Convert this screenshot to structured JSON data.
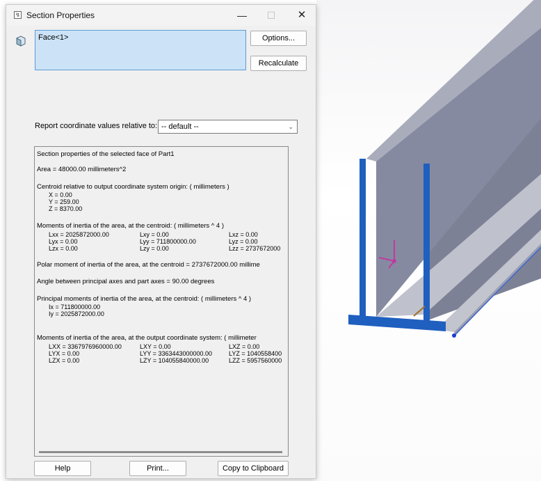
{
  "window": {
    "title": "Section Properties"
  },
  "selection": {
    "items": [
      "Face<1>"
    ]
  },
  "buttons": {
    "options": "Options...",
    "recalculate": "Recalculate",
    "help": "Help",
    "print": "Print...",
    "copy": "Copy to Clipboard"
  },
  "coord": {
    "label": "Report coordinate values relative to:",
    "selected": "-- default --"
  },
  "report": {
    "title": "Section properties of the selected face of Part1",
    "area": "Area = 48000.00 millimeters^2",
    "centroid_header": "Centroid relative to output coordinate system origin: ( millimeters )",
    "centroid": [
      "X = 0.00",
      "Y = 259.00",
      "Z = 8370.00"
    ],
    "moi_header": "Moments of inertia of the area, at the centroid: ( millimeters ^ 4 )",
    "moi": [
      [
        "Lxx = 2025872000.00",
        "Lxy = 0.00",
        "Lxz = 0.00"
      ],
      [
        "Lyx = 0.00",
        "Lyy = 711800000.00",
        "Lyz = 0.00"
      ],
      [
        "Lzx = 0.00",
        "Lzy = 0.00",
        "Lzz = 2737672000"
      ]
    ],
    "polar": "Polar moment of inertia of the area, at the centroid = 2737672000.00 millime",
    "angle": "Angle between principal axes and part axes = 90.00 degrees",
    "principal_header": "Principal moments of inertia of the area, at the centroid: ( millimeters ^ 4 )",
    "principal": [
      "Ix = 711800000.00",
      "Iy = 2025872000.00"
    ],
    "output_header": "Moments of inertia of the area, at the output coordinate system: ( millimeter",
    "output": [
      [
        "LXX = 3367976960000.00",
        "LXY = 0.00",
        "LXZ = 0.00"
      ],
      [
        "LYX = 0.00",
        "LYY = 3363443000000.00",
        "LYZ = 1040558400"
      ],
      [
        "LZX = 0.00",
        "LZY = 104055840000.00",
        "LZZ = 5957560000"
      ]
    ]
  },
  "icons": {
    "title": "properties-icon",
    "face": "part-face-icon",
    "dropdown": "chevron-down-icon"
  },
  "colors": {
    "selection_bg": "#cce3f7",
    "part_face": "#7b7f96",
    "section_highlight": "#1f5fbf"
  }
}
